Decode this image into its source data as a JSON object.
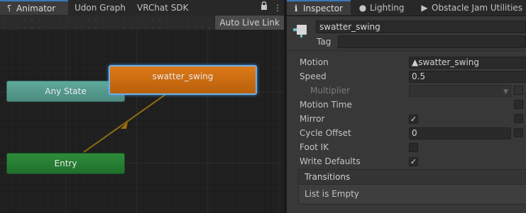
{
  "left_tabs": [
    {
      "label": "Animator",
      "icon": "animator-icon",
      "active": true
    },
    {
      "label": "Udon Graph",
      "active": false
    },
    {
      "label": "VRChat SDK",
      "active": false
    }
  ],
  "left_tab_icons": {
    "lock": "🔒",
    "more": "⋮"
  },
  "animator": {
    "auto_live_link": "Auto Live Link",
    "nodes": {
      "any_state": "Any State",
      "entry": "Entry",
      "state": "swatter_swing"
    },
    "colors": {
      "any_state": "#4b8b80",
      "entry": "#1f6f2b",
      "state": "#c86a10",
      "selection": "#6fb0ea",
      "transition": "#a0700a"
    }
  },
  "right_tabs": [
    {
      "label": "Inspector",
      "icon": "info-icon",
      "active": true
    },
    {
      "label": "Lighting",
      "icon": "lightbulb-icon",
      "active": false
    },
    {
      "label": "Obstacle Jam Utilities",
      "icon": "play-icon",
      "active": false
    }
  ],
  "inspector": {
    "name_value": "swatter_swing",
    "tag_label": "Tag",
    "tag_value": "",
    "rows": {
      "motion_label": "Motion",
      "motion_value": "▲swatter_swing",
      "speed_label": "Speed",
      "speed_value": "0.5",
      "multiplier_label": "Multiplier",
      "motion_time_label": "Motion Time",
      "mirror_label": "Mirror",
      "mirror_checked": true,
      "cycle_offset_label": "Cycle Offset",
      "cycle_offset_value": "0",
      "foot_ik_label": "Foot IK",
      "foot_ik_checked": false,
      "write_defaults_label": "Write Defaults",
      "write_defaults_checked": true
    },
    "transitions": {
      "header": "Transitions",
      "empty_text": "List is Empty"
    }
  }
}
